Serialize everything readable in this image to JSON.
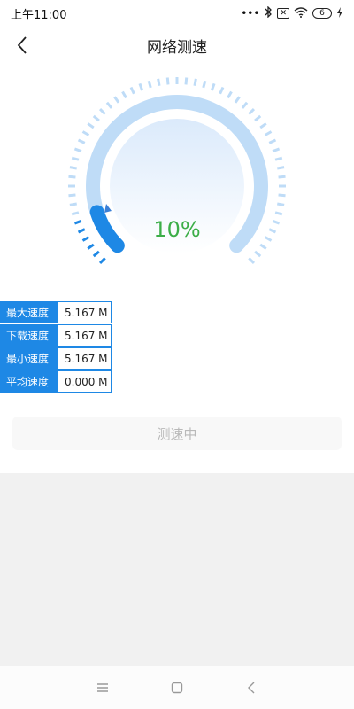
{
  "status_bar": {
    "time": "上午11:00",
    "dots": "•••",
    "battery_level": "6",
    "icons": [
      "bluetooth-icon",
      "sim-off-icon",
      "wifi-icon",
      "battery-icon",
      "charging-icon"
    ]
  },
  "header": {
    "title": "网络测速",
    "back_icon": "chevron-left-icon"
  },
  "gauge": {
    "progress_text": "10%",
    "progress": 0.1,
    "colors": {
      "accent": "#1e88e5",
      "track": "#bfdcf7",
      "percent": "#3cae48"
    }
  },
  "stats": [
    {
      "label": "最大速度",
      "value": "5.167 M"
    },
    {
      "label": "下载速度",
      "value": "5.167 M"
    },
    {
      "label": "最小速度",
      "value": "5.167 M"
    },
    {
      "label": "平均速度",
      "value": "0.000 M"
    }
  ],
  "action": {
    "label": "测速中"
  },
  "nav": {
    "icons": [
      "menu-icon",
      "home-icon",
      "back-icon"
    ]
  }
}
